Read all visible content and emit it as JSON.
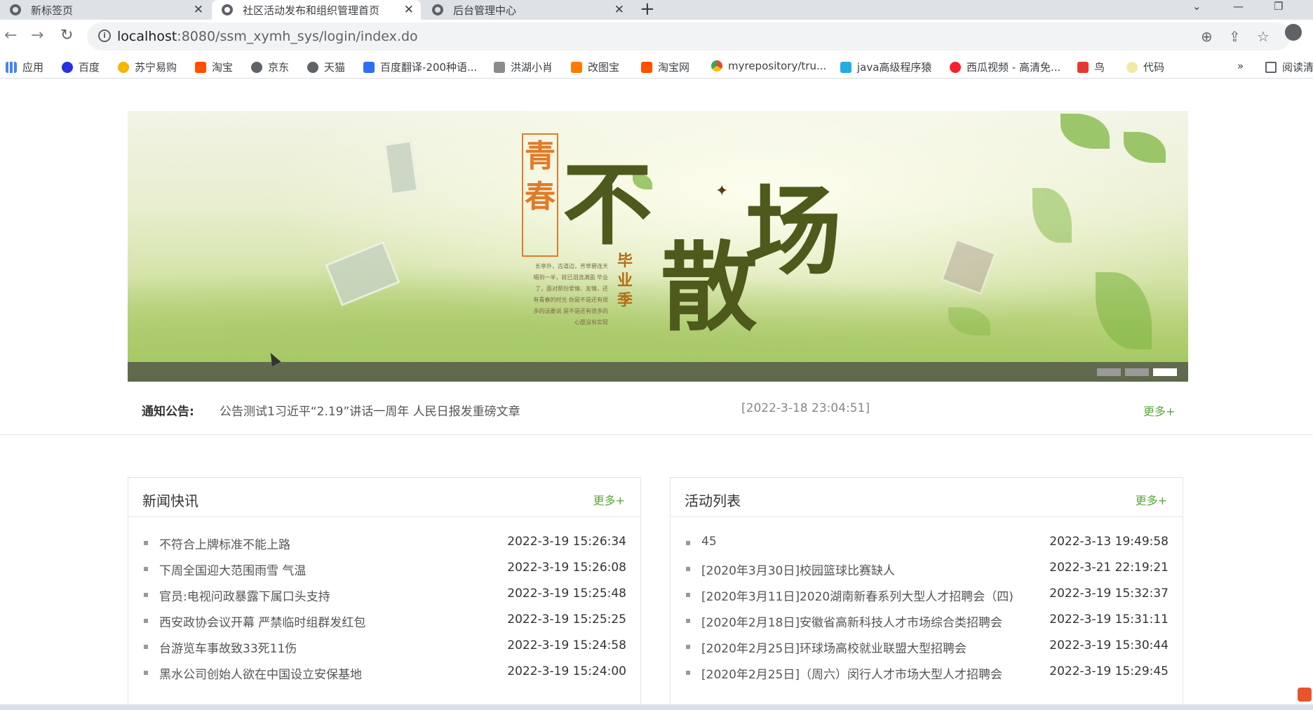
{
  "browser": {
    "tabs": [
      {
        "label": "新标签页"
      },
      {
        "label": "社区活动发布和组织管理首页"
      },
      {
        "label": "后台管理中心"
      }
    ],
    "url_host": "localhost",
    "url_rest": ":8080/ssm_xymh_sys/login/index.do",
    "bookmarks": [
      {
        "label": "应用",
        "icon": "apps-grid-icon"
      },
      {
        "label": "百度",
        "icon": "baidu-paw-icon"
      },
      {
        "label": "苏宁易购",
        "icon": "suning-icon"
      },
      {
        "label": "淘宝",
        "icon": "taobao-icon"
      },
      {
        "label": "京东",
        "icon": "globe-icon"
      },
      {
        "label": "天猫",
        "icon": "globe-icon"
      },
      {
        "label": "百度翻译-200种语...",
        "icon": "translate-icon"
      },
      {
        "label": "洪湖小肖",
        "icon": "bird-icon"
      },
      {
        "label": "改图宝",
        "icon": "image-tool-icon"
      },
      {
        "label": "淘宝网",
        "icon": "taobao-icon"
      },
      {
        "label": "myrepository/tru...",
        "icon": "chrome-icon"
      },
      {
        "label": "java高级程序猿",
        "icon": "bilibili-icon"
      },
      {
        "label": "西瓜视频 - 高清免...",
        "icon": "play-icon"
      },
      {
        "label": "鸟",
        "icon": "bird-icon"
      },
      {
        "label": "代码",
        "icon": "moon-icon"
      },
      {
        "label": "»",
        "icon": ""
      },
      {
        "label": "阅读清",
        "icon": "reading-list-icon"
      }
    ],
    "colors": {
      "accent": "#5aa83b",
      "chrome_bg": "#dee1e6"
    }
  },
  "banner": {
    "qingchun": "青春",
    "headline_chars": [
      "不",
      "散",
      "场"
    ],
    "byj": "毕业季",
    "poem": "长亭外，古道边，芳草碧连天 唱到一半，就已泪流满面 毕业了，面对那份爱情、友情，还有青春的时光 你是不是还有很多的话要说 是不是还有很多的心愿没有实现",
    "carousel_count": 3,
    "carousel_active": 3
  },
  "notice": {
    "label": "通知公告:",
    "text": "公告测试1习近平“2.19”讲话一周年 人民日报发重磅文章",
    "date": "[2022-3-18 23:04:51]",
    "more": "更多+"
  },
  "news": {
    "title": "新闻快讯",
    "more": "更多+",
    "items": [
      {
        "title": "不符合上牌标准不能上路",
        "date": "2022-3-19 15:26:34"
      },
      {
        "title": "下周全国迎大范围雨雪 气温",
        "date": "2022-3-19 15:26:08"
      },
      {
        "title": "官员:电视问政暴露下属口头支持",
        "date": "2022-3-19 15:25:48"
      },
      {
        "title": "西安政协会议开幕 严禁临时组群发红包",
        "date": "2022-3-19 15:25:25"
      },
      {
        "title": "台游览车事故致33死11伤",
        "date": "2022-3-19 15:24:58"
      },
      {
        "title": "黑水公司创始人欲在中国设立安保基地",
        "date": "2022-3-19 15:24:00"
      }
    ]
  },
  "activities": {
    "title": "活动列表",
    "more": "更多+",
    "items": [
      {
        "title": "45",
        "date": "2022-3-13 19:49:58"
      },
      {
        "title": "[2020年3月30日]校园篮球比赛缺人",
        "date": "2022-3-21 22:19:21"
      },
      {
        "title": "[2020年3月11日]2020湖南新春系列大型人才招聘会（四)",
        "date": "2022-3-19 15:32:37"
      },
      {
        "title": "[2020年2月18日]安徽省高新科技人才市场综合类招聘会",
        "date": "2022-3-19 15:31:11"
      },
      {
        "title": "[2020年2月25日]环球场高校就业联盟大型招聘会",
        "date": "2022-3-19 15:30:44"
      },
      {
        "title": "[2020年2月25日]（周六）闵行人才市场大型人才招聘会",
        "date": "2022-3-19 15:29:45"
      }
    ]
  }
}
